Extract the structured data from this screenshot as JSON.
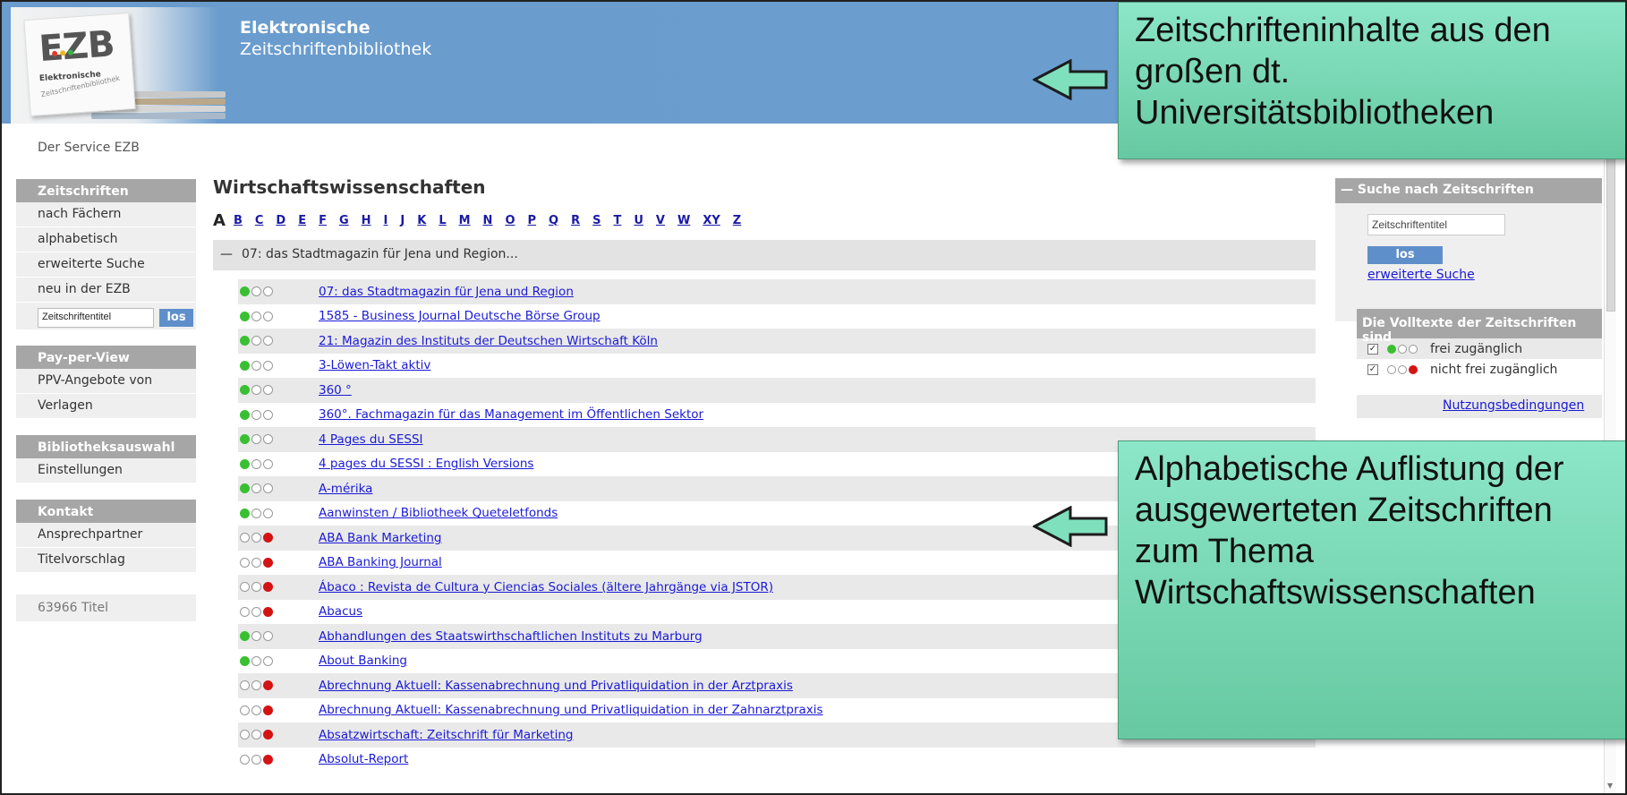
{
  "header": {
    "logo_text": "EZB",
    "logo_sub1": "Elektronische",
    "logo_sub2": "Zeitschriftenbibliothek",
    "title_line1": "Elektronische",
    "title_line2": "Zeitschriftenbibliothek"
  },
  "service": "Der Service EZB",
  "sidebar": {
    "blocks": [
      {
        "head": "Zeitschriften",
        "items": [
          "nach Fächern",
          "alphabetisch",
          "erweiterte Suche",
          "neu in der EZB"
        ]
      },
      {
        "head": "Pay-per-View",
        "items": [
          "PPV-Angebote von",
          "Verlagen"
        ]
      },
      {
        "head": "Bibliotheksauswahl",
        "items": [
          "Einstellungen"
        ]
      },
      {
        "head": "Kontakt",
        "items": [
          "Ansprechpartner",
          "Titelvorschlag"
        ]
      }
    ],
    "search_value": "Zeitschriftentitel",
    "search_button": "los",
    "count": "63966 Titel"
  },
  "main": {
    "title": "Wirtschaftswissenschaften",
    "current_letter": "A",
    "letters": [
      "B",
      "C",
      "D",
      "E",
      "F",
      "G",
      "H",
      "I",
      "J",
      "K",
      "L",
      "M",
      "N",
      "O",
      "P",
      "Q",
      "R",
      "S",
      "T",
      "U",
      "V",
      "W",
      "XY",
      "Z"
    ],
    "group_label": "07: das Stadtmagazin für Jena und Region...",
    "rows": [
      {
        "status": "green",
        "title": "07: das Stadtmagazin für Jena und Region"
      },
      {
        "status": "green",
        "title": "1585 - Business Journal Deutsche Börse Group"
      },
      {
        "status": "green",
        "title": "21: Magazin des Instituts der Deutschen Wirtschaft Köln"
      },
      {
        "status": "green",
        "title": "3-Löwen-Takt aktiv"
      },
      {
        "status": "green",
        "title": "360 °"
      },
      {
        "status": "green",
        "title": "360°. Fachmagazin für das Management im Öffentlichen Sektor"
      },
      {
        "status": "green",
        "title": "4 Pages du SESSI"
      },
      {
        "status": "green",
        "title": "4 pages du SESSI : English Versions"
      },
      {
        "status": "green",
        "title": "A-mérika"
      },
      {
        "status": "green",
        "title": "Aanwinsten / Bibliotheek Queteletfonds"
      },
      {
        "status": "red",
        "title": "ABA Bank Marketing"
      },
      {
        "status": "red",
        "title": "ABA Banking Journal"
      },
      {
        "status": "red",
        "title": "Ábaco : Revista de Cultura y Ciencias Sociales (ältere Jahrgänge via JSTOR)"
      },
      {
        "status": "red",
        "title": "Abacus"
      },
      {
        "status": "green",
        "title": "Abhandlungen des Staatswirthschaftlichen Instituts zu Marburg"
      },
      {
        "status": "green",
        "title": "About Banking"
      },
      {
        "status": "red",
        "title": "Abrechnung Aktuell: Kassenabrechnung und Privatliquidation in der Arztpraxis"
      },
      {
        "status": "red",
        "title": "Abrechnung Aktuell: Kassenabrechnung und Privatliquidation in der Zahnarztpraxis"
      },
      {
        "status": "red",
        "title": "Absatzwirtschaft: Zeitschrift für Marketing"
      },
      {
        "status": "red",
        "title": "Absolut-Report"
      }
    ]
  },
  "right_panel": {
    "search_head": "Suche nach Zeitschriften",
    "search_placeholder": "Zeitschriftentitel",
    "search_button": "los",
    "advanced_link": "erweiterte Suche",
    "avail_head": "Die Volltexte der Zeitschriften sind",
    "avail_free": "frei zugänglich",
    "avail_not_free": "nicht frei zugänglich",
    "terms_link": "Nutzungsbedingungen"
  },
  "callouts": {
    "top": "Zeitschrifteninhalte aus den großen dt. Universitätsbibliotheken",
    "bottom": "Alphabetische Auflistung der ausgewerteten Zeitschriften zum Thema Wirtschaftswissenschaften"
  },
  "colors": {
    "header_blue": "#6b9dcf",
    "callout_green": "#74d4ae",
    "link_blue": "#1a1ad6",
    "status_green": "#39c032",
    "status_red": "#d41313"
  }
}
